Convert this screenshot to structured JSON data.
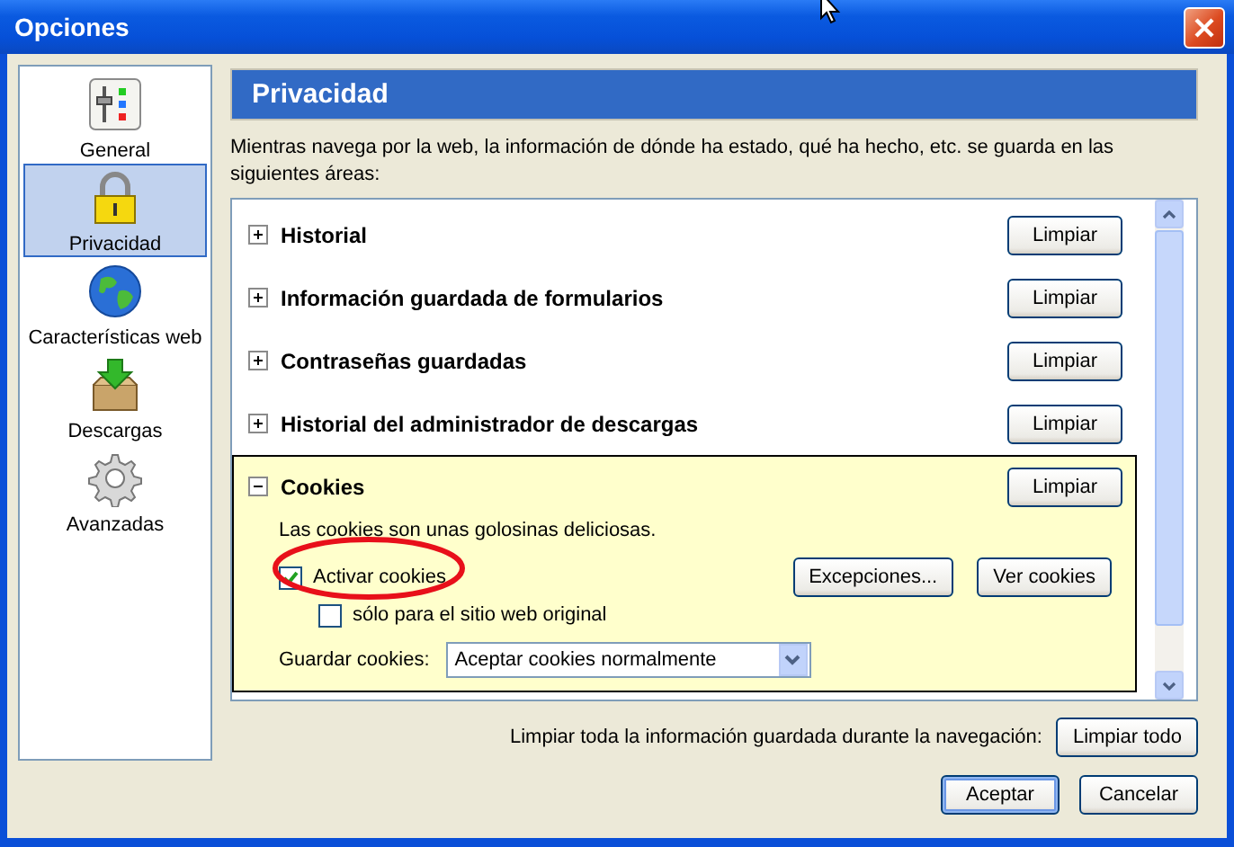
{
  "window": {
    "title": "Opciones"
  },
  "sidebar": {
    "items": [
      {
        "label": "General",
        "kind": "general",
        "selected": false
      },
      {
        "label": "Privacidad",
        "kind": "privacy",
        "selected": true
      },
      {
        "label": "Características web",
        "kind": "web",
        "selected": false
      },
      {
        "label": "Descargas",
        "kind": "downloads",
        "selected": false
      },
      {
        "label": "Avanzadas",
        "kind": "advanced",
        "selected": false
      }
    ]
  },
  "panel": {
    "title": "Privacidad",
    "description": "Mientras navega por la web, la información de dónde ha estado, qué ha hecho, etc. se guarda en las siguientes áreas:",
    "sections": [
      {
        "title": "Historial",
        "expanded": false,
        "button": "Limpiar"
      },
      {
        "title": "Información guardada de formularios",
        "expanded": false,
        "button": "Limpiar"
      },
      {
        "title": "Contraseñas guardadas",
        "expanded": false,
        "button": "Limpiar"
      },
      {
        "title": "Historial del administrador de descargas",
        "expanded": false,
        "button": "Limpiar"
      },
      {
        "title": "Cookies",
        "expanded": true,
        "button": "Limpiar",
        "description": "Las cookies son unas golosinas deliciosas.",
        "options": [
          {
            "label": "Activar cookies",
            "checked": true,
            "children": [
              {
                "label": "sólo para el sitio web original",
                "checked": false
              }
            ]
          }
        ],
        "buttons": [
          "Excepciones...",
          "Ver cookies"
        ],
        "keep": {
          "label": "Guardar cookies:",
          "value": "Aceptar cookies normalmente"
        }
      }
    ],
    "clear_all": {
      "label": "Limpiar toda la información guardada durante la navegación:",
      "button": "Limpiar todo"
    }
  },
  "buttons": [
    {
      "label": "Aceptar",
      "default": true
    },
    {
      "label": "Cancelar",
      "default": false
    }
  ]
}
